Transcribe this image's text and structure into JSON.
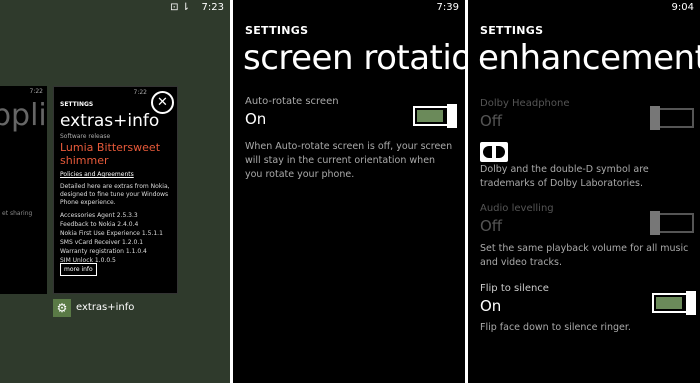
{
  "panel1": {
    "status_icons": "⊡ ⇂",
    "clock": "7:23",
    "left_card": {
      "time": "7:22",
      "title_clip": "pplicat",
      "small_text": "et sharing"
    },
    "card": {
      "time": "7:22",
      "header": "SETTINGS",
      "title": "extras+info",
      "subtitle": "Software release",
      "release": "Lumia Bittersweet shimmer",
      "policies": "Policies and Agreements",
      "description": "Detailed here are extras from Nokia, designed to fine tune your Windows Phone experience.",
      "items": [
        "Accessories Agent 2.5.3.3",
        "Feedback to Nokia 2.4.0.4",
        "Nokia First Use Experience 1.5.1.1",
        "SMS vCard Receiver 1.2.0.1",
        "Warranty registration 1.1.0.4",
        "SIM Unlock 1.0.0.5"
      ],
      "more_button": "more info"
    },
    "close_icon": "✕",
    "app_name": "extras+info"
  },
  "panel2": {
    "clock": "7:39",
    "header": "SETTINGS",
    "title": "screen rotation",
    "setting_label": "Auto-rotate screen",
    "setting_value": "On",
    "toggle_on": true,
    "note": "When Auto-rotate screen is off, your screen will stay in the current orientation when you rotate your phone."
  },
  "panel3": {
    "clock": "9:04",
    "header": "SETTINGS",
    "title": "enhancements",
    "dolby_label": "Dolby Headphone",
    "dolby_value": "Off",
    "dolby_note": "Dolby and the double-D symbol are trademarks of Dolby Laboratories.",
    "audio_label": "Audio levelling",
    "audio_value": "Off",
    "audio_note": "Set the same playback volume for all music and video tracks.",
    "flip_label": "Flip to silence",
    "flip_value": "On",
    "flip_note": "Flip face down to silence ringer."
  },
  "colors": {
    "accent": "#6b8a5a",
    "tile": "#5a7a46",
    "release_red": "#e85a3a"
  }
}
